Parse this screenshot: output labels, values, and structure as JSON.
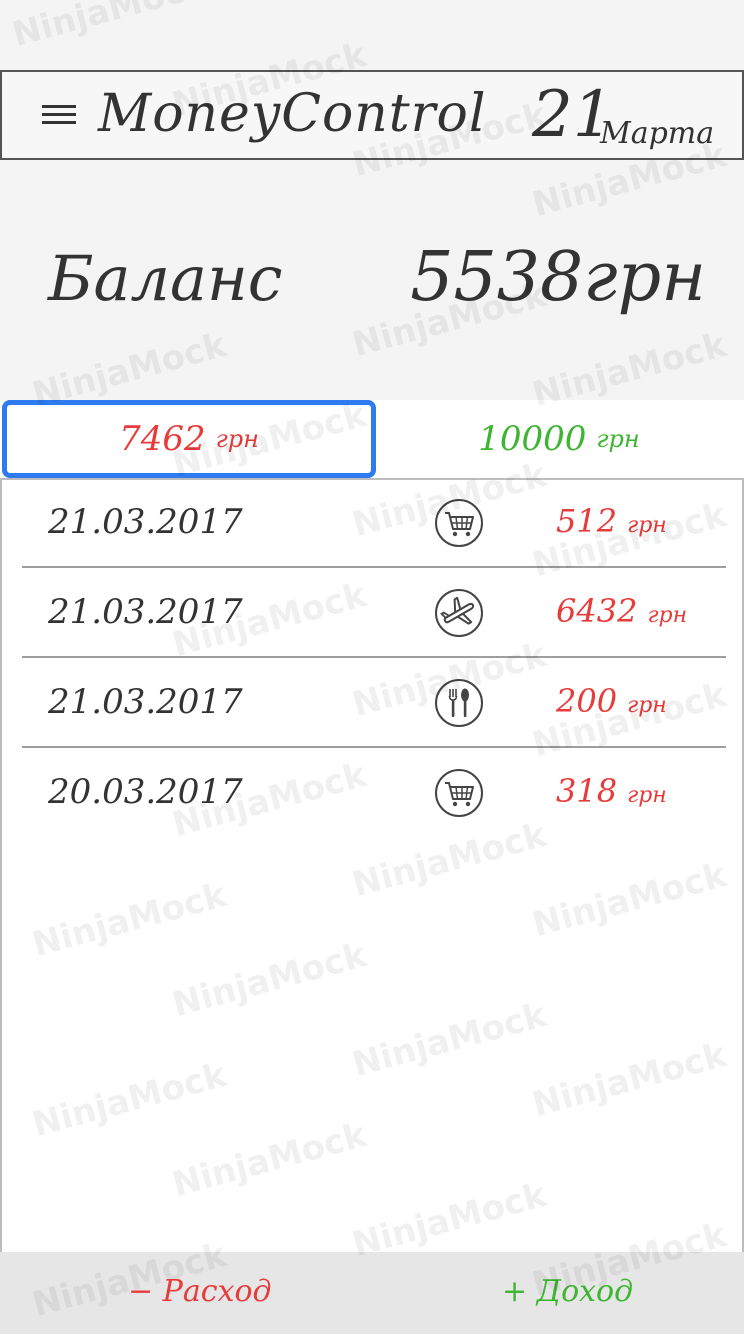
{
  "header": {
    "menu_icon": "hamburger-menu-icon",
    "title": "MoneyControl",
    "date_day": "21",
    "date_month": "Марта"
  },
  "balance": {
    "label": "Баланс",
    "value": "5538грн"
  },
  "tabs": {
    "expense": {
      "amount": "7462",
      "unit": "грн",
      "color": "#e83b3b",
      "selected": true
    },
    "income": {
      "amount": "10000",
      "unit": "грн",
      "color": "#3db530",
      "selected": false
    }
  },
  "transactions": [
    {
      "date": "21.03.2017",
      "icon": "shopping-cart-icon",
      "amount": "512",
      "unit": "грн"
    },
    {
      "date": "21.03.2017",
      "icon": "airplane-icon",
      "amount": "6432",
      "unit": "грн"
    },
    {
      "date": "21.03.2017",
      "icon": "fork-spoon-icon",
      "amount": "200",
      "unit": "грн"
    },
    {
      "date": "20.03.2017",
      "icon": "shopping-cart-icon",
      "amount": "318",
      "unit": "грн"
    }
  ],
  "bottom_bar": {
    "expense_label": "− Расход",
    "income_label": "+ Доход"
  },
  "watermark": "NinjaMock",
  "colors": {
    "expense": "#e83b3b",
    "income": "#3db530",
    "selected_tab_border": "#2d7bef"
  }
}
